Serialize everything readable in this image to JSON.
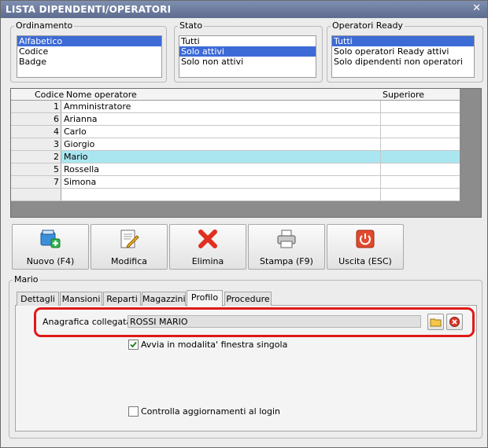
{
  "window": {
    "title": "LISTA DIPENDENTI/OPERATORI",
    "close_glyph": "✕"
  },
  "ordinamento": {
    "label": "Ordinamento",
    "items": [
      "Alfabetico",
      "Codice",
      "Badge"
    ],
    "selected": "Alfabetico"
  },
  "stato": {
    "label": "Stato",
    "items": [
      "Tutti",
      "Solo attivi",
      "Solo non attivi"
    ],
    "selected": "Solo attivi"
  },
  "operatori_ready": {
    "label": "Operatori Ready",
    "items": [
      "Tutti",
      "Solo operatori Ready attivi",
      "Solo dipendenti non operatori"
    ],
    "selected": "Tutti"
  },
  "grid": {
    "columns": [
      "Codice",
      "Nome operatore",
      "Superiore"
    ],
    "rows": [
      {
        "code": "1",
        "name": "Amministratore",
        "superiore": ""
      },
      {
        "code": "6",
        "name": "Arianna",
        "superiore": ""
      },
      {
        "code": "4",
        "name": "Carlo",
        "superiore": ""
      },
      {
        "code": "3",
        "name": "Giorgio",
        "superiore": ""
      },
      {
        "code": "2",
        "name": "Mario",
        "superiore": ""
      },
      {
        "code": "5",
        "name": "Rossella",
        "superiore": ""
      },
      {
        "code": "7",
        "name": "Simona",
        "superiore": ""
      }
    ],
    "selected_name": "Mario"
  },
  "toolbar": {
    "nuovo": "Nuovo (F4)",
    "modifica": "Modifica",
    "elimina": "Elimina",
    "stampa": "Stampa (F9)",
    "uscita": "Uscita (ESC)"
  },
  "detail": {
    "group_label": "Mario",
    "tabs": [
      "Dettagli",
      "Mansioni",
      "Reparti",
      "Magazzini",
      "Profilo",
      "Procedure"
    ],
    "active_tab": "Profilo",
    "anagrafica_label": "Anagrafica collegata :",
    "anagrafica_value": "ROSSI MARIO",
    "avvia_label": "Avvia in modalita' finestra singola",
    "avvia_checked": true,
    "controlla_label": "Controlla aggiornamenti al login",
    "controlla_checked": false
  },
  "colors": {
    "highlight_box": "#e01919",
    "selected_row": "#a9e6f0",
    "list_selection": "#3d6bd6",
    "title_bar": "#6b7a9c"
  }
}
